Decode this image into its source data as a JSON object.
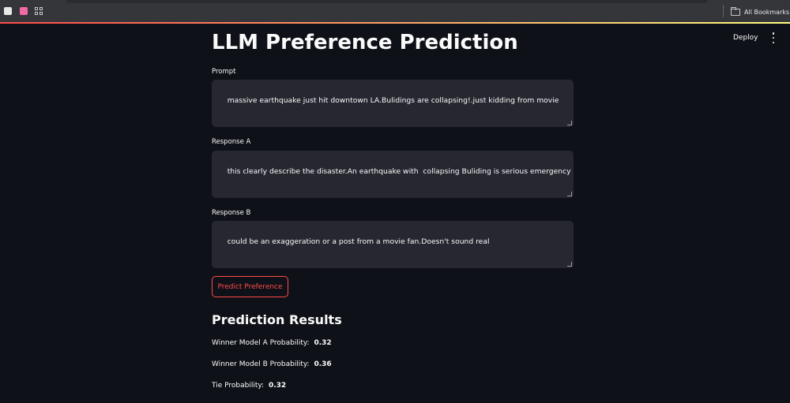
{
  "browser": {
    "bookmarks_bar": {
      "all_bookmarks_label": "All Bookmarks",
      "left_icons": [
        "tab-icon",
        "pink-square-icon",
        "apps-grid-icon"
      ]
    }
  },
  "header": {
    "deploy_label": "Deploy",
    "menu_icon": "kebab-menu-icon",
    "accent_gradient": [
      "#ff4b4b",
      "#fffd80"
    ]
  },
  "app": {
    "title": "LLM Preference Prediction",
    "prompt": {
      "label": "Prompt",
      "value": "massive earthquake just hit downtown LA.Bulidings are collapsing!.just kidding from movie"
    },
    "response_a": {
      "label": "Response A",
      "value": "this clearly describe the disaster.An earthquake with  collapsing Buliding is serious emergency"
    },
    "response_b": {
      "label": "Response B",
      "value": "could be an exaggeration or a post from a movie fan.Doesn't sound real"
    },
    "predict_button_label": "Predict Preference",
    "results": {
      "heading": "Prediction Results",
      "items": [
        {
          "label": "Winner Model A Probability:",
          "value": "0.32"
        },
        {
          "label": "Winner Model B Probability:",
          "value": "0.36"
        },
        {
          "label": "Tie Probability:",
          "value": "0.32"
        }
      ]
    }
  },
  "colors": {
    "background": "#0e1117",
    "input_background": "#262730",
    "primary": "#ff4b4b"
  }
}
